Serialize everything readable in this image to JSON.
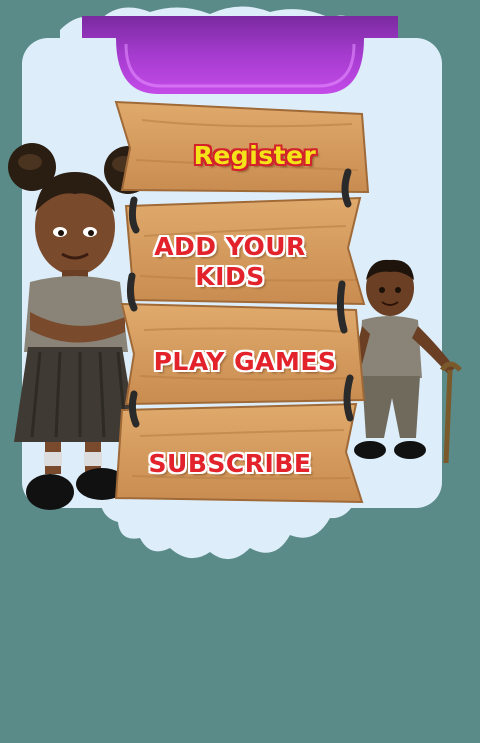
{
  "colors": {
    "background": "#5b8b88",
    "panel": "#ddeefa",
    "banner": "#a53bcf",
    "wood": "#d59a5e",
    "label_red": "#e3232b",
    "label_yellow": "#f5e31a"
  },
  "menu": {
    "register_label": "Register",
    "add_kids_label_line1": "ADD YOUR",
    "add_kids_label_line2": "KIDS",
    "play_games_label": "PLAY GAMES",
    "subscribe_label": "SUBSCRIBE"
  },
  "characters": {
    "left": "girl-character",
    "right": "boy-character"
  }
}
